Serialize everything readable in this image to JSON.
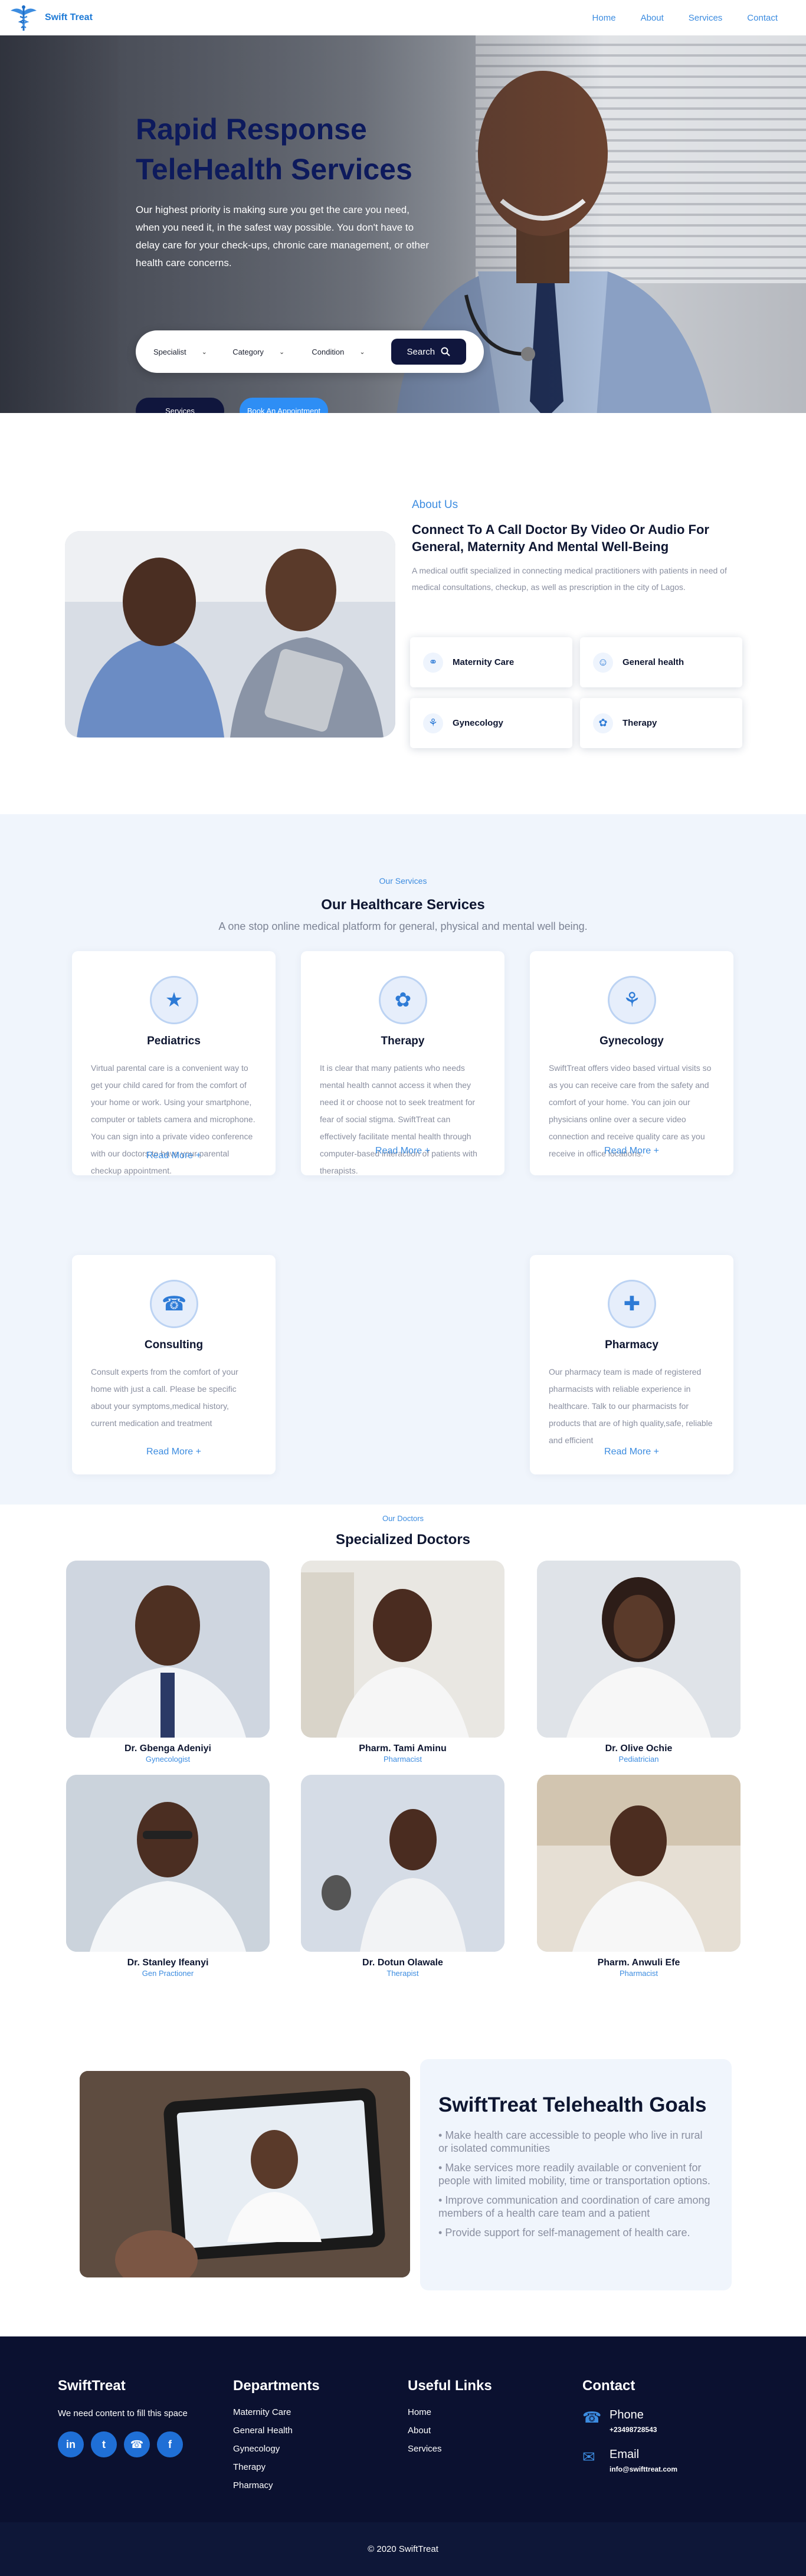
{
  "nav": {
    "brand": "Swift Treat",
    "links": [
      "Home",
      "About",
      "Services",
      "Contact"
    ]
  },
  "hero": {
    "title_line1": "Rapid Response",
    "title_line2": "TeleHealth Services",
    "text": "Our highest priority is making sure you get the care you need, when you need it, in the safest way possible. You don't have to delay care for your check-ups, chronic care management, or other health care concerns.",
    "filters": [
      "Specialist",
      "Category",
      "Condition"
    ],
    "search_label": "Search",
    "services_button": "Services",
    "appointment_button": "Book An Appointment"
  },
  "about": {
    "eyebrow": "About Us",
    "title": "Connect To A Call Doctor By Video Or Audio For General, Maternity And Mental Well-Being",
    "text": "A medical outfit specialized in connecting medical practitioners with patients in need of medical consultations, checkup, as well as prescription in the city of Lagos.",
    "cards": [
      "Maternity Care",
      "General health",
      "Gynecology",
      "Therapy"
    ]
  },
  "services": {
    "eyebrow": "Our Services",
    "title": "Our Healthcare Services",
    "subtitle": "A one stop online medical platform for general, physical and mental well being.",
    "read_more": "Read More +",
    "items": [
      {
        "title": "Pediatrics",
        "text": "Virtual parental care is a convenient way to get your child cared for from the comfort of your home or work. Using your smartphone, computer or tablets camera and microphone. You can sign into a private video conference with our doctors to have your parental checkup appointment."
      },
      {
        "title": "Therapy",
        "text": "It is clear that many patients who needs mental health cannot access it when they need it or choose not to seek treatment for fear of social stigma. SwiftTreat can effectively facilitate mental health through computer-based interaction of patients with therapists."
      },
      {
        "title": "Gynecology",
        "text": "SwiftTreat offers video based virtual visits so as you can receive care from the safety and comfort of your home. You can join our physicians online over a secure video connection and receive quality care as you receive in office locations."
      },
      {
        "title": "Consulting",
        "text": "Consult experts from the comfort of your home with just a call. Please be specific about your symptoms,medical history, current medication and treatment"
      },
      {
        "title": "Pharmacy",
        "text": "Our pharmacy team is made of registered pharmacists with reliable experience in healthcare. Talk to our pharmacists for products that are of high quality,safe, reliable and efficient"
      }
    ]
  },
  "doctors": {
    "eyebrow": "Our Doctors",
    "title": "Specialized Doctors",
    "items": [
      {
        "name": "Dr. Gbenga Adeniyi",
        "role": "Gynecologist"
      },
      {
        "name": "Pharm. Tami Aminu",
        "role": "Pharmacist"
      },
      {
        "name": "Dr. Olive Ochie",
        "role": "Pediatrician"
      },
      {
        "name": "Dr. Stanley Ifeanyi",
        "role": "Gen Practioner"
      },
      {
        "name": "Dr. Dotun Olawale",
        "role": "Therapist"
      },
      {
        "name": "Pharm. Anwuli Efe",
        "role": "Pharmacist"
      }
    ]
  },
  "goals": {
    "title": "SwiftTreat Telehealth Goals",
    "items": [
      "Make health care accessible to people who live in rural or isolated communities",
      "Make services more readily available or convenient for people with limited mobility, time or transportation options.",
      "Improve communication and coordination of care among members of a health care team and a patient",
      "Provide support for self-management of health care."
    ]
  },
  "footer": {
    "brand": "SwiftTreat",
    "brand_text": "We need content to fill this space",
    "socials": [
      "in",
      "t",
      "☎",
      "f"
    ],
    "departments_title": "Departments",
    "departments": [
      "Maternity Care",
      "General Health",
      "Gynecology",
      "Therapy",
      "Pharmacy"
    ],
    "links_title": "Useful Links",
    "links": [
      "Home",
      "About",
      "Services"
    ],
    "contact_title": "Contact",
    "phone_label": "Phone",
    "phone_value": "+23498728543",
    "email_label": "Email",
    "email_value": "info@swifttreat.com",
    "copyright": "© 2020 SwiftTreat"
  },
  "colors": {
    "navy": "#0e1631",
    "accent": "#2e8ef5",
    "link": "#3c8ce0",
    "footer": "#0b1130"
  }
}
